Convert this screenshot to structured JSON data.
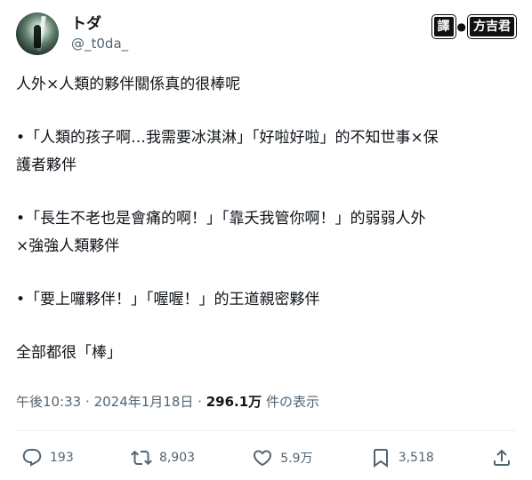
{
  "author": {
    "display_name": "トダ",
    "handle": "@_t0da_"
  },
  "watermark": {
    "left": "譯",
    "right": "方吉君"
  },
  "post": {
    "paragraphs": [
      "人外×人類的夥伴關係真的很棒呢",
      "•「人類的孩子啊…我需要冰淇淋」「好啦好啦」的不知世事×保\n護者夥伴",
      "•「長生不老也是會痛的啊！」「靠夭我管你啊！」的弱弱人外\n×強強人類夥伴",
      "•「要上囉夥伴！」「喔喔！」的王道親密夥伴",
      "全部都很「棒」"
    ]
  },
  "meta": {
    "time": "午後10:33",
    "separator": "·",
    "date": "2024年1月18日",
    "views_count": "296.1万",
    "views_label": "件の表示"
  },
  "actions": {
    "reply": {
      "icon": "reply-icon",
      "count": "193"
    },
    "repost": {
      "icon": "repost-icon",
      "count": "8,903"
    },
    "like": {
      "icon": "heart-icon",
      "count": "5.9万"
    },
    "bookmark": {
      "icon": "bookmark-icon",
      "count": "3,518"
    },
    "share": {
      "icon": "share-icon"
    }
  }
}
